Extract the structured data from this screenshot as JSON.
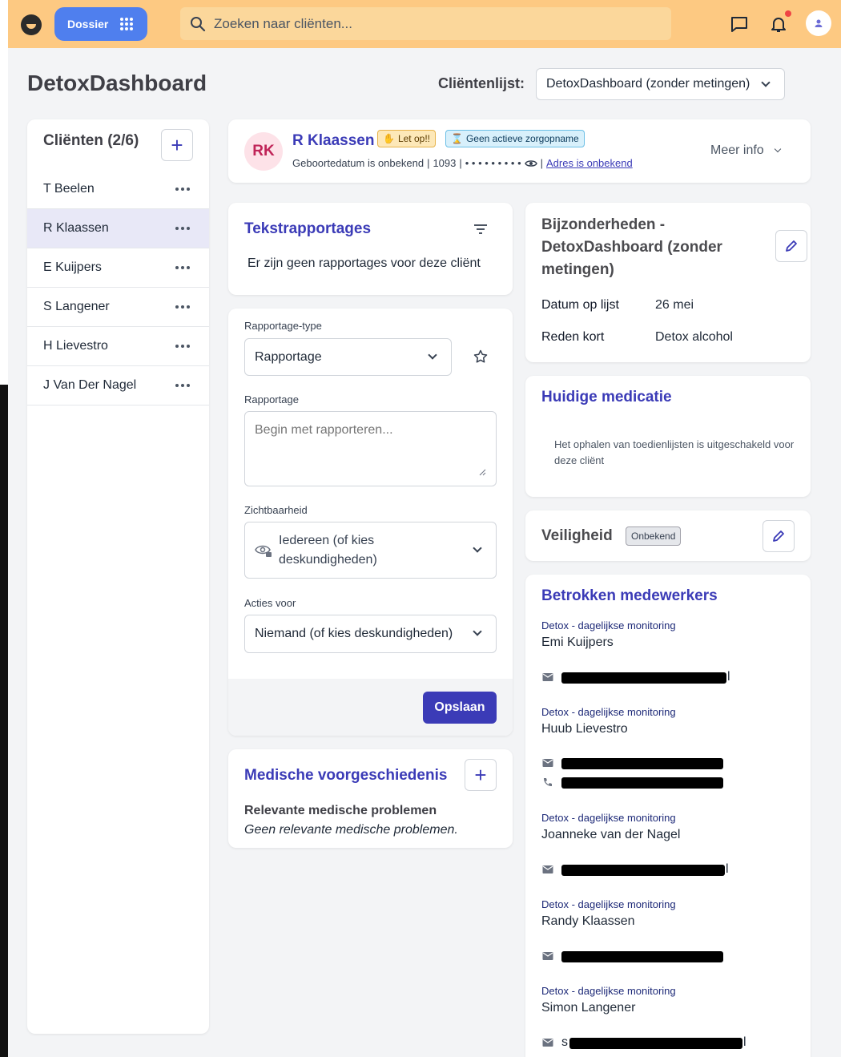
{
  "topbar": {
    "dossier_label": "Dossier",
    "search_placeholder": "Zoeken naar cliënten..."
  },
  "page": {
    "title": "DetoxDashboard",
    "client_list_label": "Cliëntenlijst:",
    "client_list_selected": "DetoxDashboard (zonder metingen)"
  },
  "clients": {
    "title": "Cliënten (2/6)",
    "items": [
      {
        "name": "T Beelen"
      },
      {
        "name": "R Klaassen"
      },
      {
        "name": "E Kuijpers"
      },
      {
        "name": "S Langener"
      },
      {
        "name": "H Lievestro"
      },
      {
        "name": "J Van Der Nagel"
      }
    ]
  },
  "client_header": {
    "initials": "RK",
    "name": "R Klaassen",
    "badge_warning": "Let op!!",
    "badge_info": "Geen actieve zorgopname",
    "birthdate": "Geboortedatum is onbekend",
    "sep": "|",
    "number": "1093",
    "masked": "• • • • • • • • •",
    "address": "Adres is onbekend",
    "more_info": "Meer info"
  },
  "tekstrapportages": {
    "title": "Tekstrapportages",
    "empty": "Er zijn geen rapportages voor deze cliënt"
  },
  "form": {
    "type_label": "Rapportage-type",
    "type_value": "Rapportage",
    "report_label": "Rapportage",
    "report_placeholder": "Begin met rapporteren...",
    "visibility_label": "Zichtbaarheid",
    "visibility_value": "Iedereen (of kies deskundigheden)",
    "actions_label": "Acties voor",
    "actions_value": "Niemand (of kies deskundigheden)",
    "save": "Opslaan"
  },
  "medisch": {
    "title": "Medische voorgeschiedenis",
    "subtitle": "Relevante medische problemen",
    "empty": "Geen relevante medische problemen."
  },
  "bijzonderheden": {
    "title": "Bijzonderheden - DetoxDashboard (zonder metingen)",
    "rows": [
      {
        "key": "Datum op lijst",
        "value": "26 mei"
      },
      {
        "key": "Reden kort",
        "value": "Detox alcohol"
      }
    ]
  },
  "medicatie": {
    "title": "Huidige medicatie",
    "message": "Het ophalen van toedienlijsten is uitgeschakeld voor deze cliënt"
  },
  "veiligheid": {
    "title": "Veiligheid",
    "badge": "Onbekend"
  },
  "betrokken": {
    "title": "Betrokken medewerkers",
    "staff": [
      {
        "role": "Detox - dagelijkse monitoring",
        "name": "Emi Kuijpers",
        "email_tail": "l"
      },
      {
        "role": "Detox - dagelijkse monitoring",
        "name": "Huub Lievestro",
        "email_tail": ""
      },
      {
        "role": "Detox - dagelijkse monitoring",
        "name": "Joanneke van der Nagel",
        "email_tail": "l"
      },
      {
        "role": "Detox - dagelijkse monitoring",
        "name": "Randy Klaassen",
        "email_tail": ""
      },
      {
        "role": "Detox - dagelijkse monitoring",
        "name": "Simon Langener",
        "email_tail": "l",
        "email_head": "s"
      }
    ]
  },
  "colors": {
    "topbar": "#fdc982",
    "primary": "#3b3bb7",
    "dossier": "#4f7fee"
  }
}
